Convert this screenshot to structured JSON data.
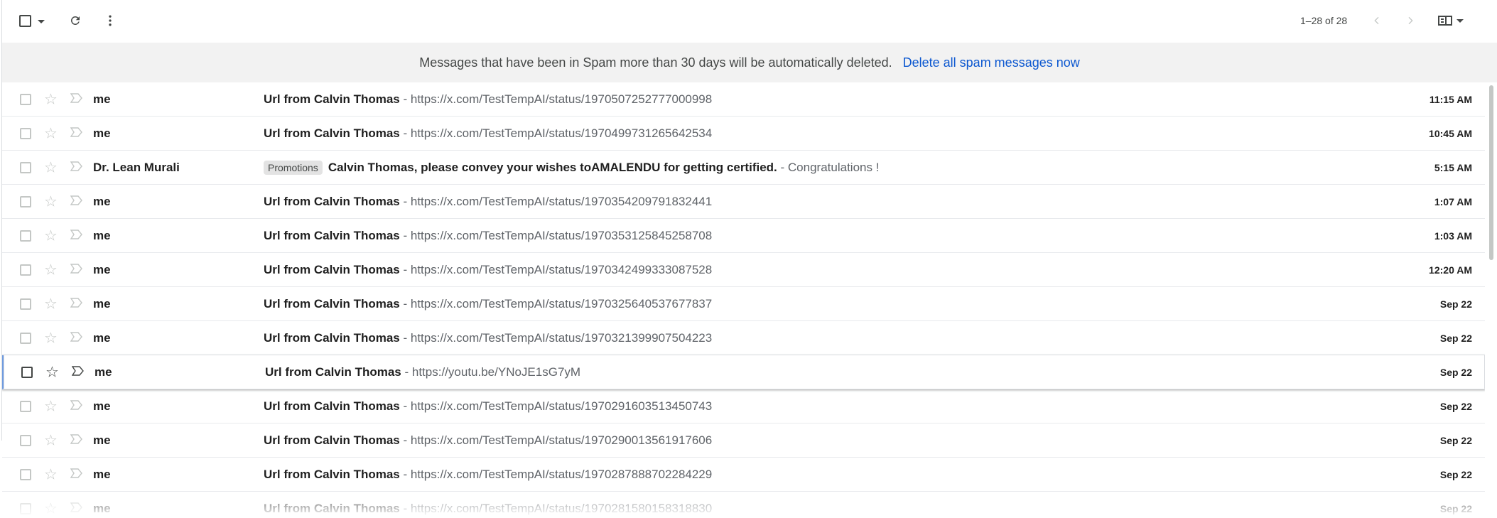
{
  "toolbar": {
    "range_text": "1–28 of 28",
    "icons": [
      "select-all-checkbox",
      "select-dropdown-caret",
      "refresh",
      "more-vert",
      "newer-chevron",
      "older-chevron",
      "split-pane-toggle"
    ]
  },
  "banner": {
    "text": "Messages that have been in Spam more than 30 days will be automatically deleted.",
    "link": "Delete all spam messages now"
  },
  "emails": [
    {
      "sender": "me",
      "subject": "Url from Calvin Thomas",
      "snippet": "- https://x.com/TestTempAI/status/1970507252777000998",
      "date": "11:15 AM"
    },
    {
      "sender": "me",
      "subject": "Url from Calvin Thomas",
      "snippet": "- https://x.com/TestTempAI/status/1970499731265642534",
      "date": "10:45 AM"
    },
    {
      "sender": "Dr. Lean Murali",
      "label": "Promotions",
      "subject": "Calvin Thomas, please convey your wishes toAMALENDU for getting certified.",
      "snippet": "- Congratulations !",
      "date": "5:15 AM"
    },
    {
      "sender": "me",
      "subject": "Url from Calvin Thomas",
      "snippet": "- https://x.com/TestTempAI/status/1970354209791832441",
      "date": "1:07 AM"
    },
    {
      "sender": "me",
      "subject": "Url from Calvin Thomas",
      "snippet": "- https://x.com/TestTempAI/status/1970353125845258708",
      "date": "1:03 AM"
    },
    {
      "sender": "me",
      "subject": "Url from Calvin Thomas",
      "snippet": "- https://x.com/TestTempAI/status/1970342499333087528",
      "date": "12:20 AM"
    },
    {
      "sender": "me",
      "subject": "Url from Calvin Thomas",
      "snippet": "- https://x.com/TestTempAI/status/1970325640537677837",
      "date": "Sep 22"
    },
    {
      "sender": "me",
      "subject": "Url from Calvin Thomas",
      "snippet": "- https://x.com/TestTempAI/status/1970321399907504223",
      "date": "Sep 22"
    },
    {
      "sender": "me",
      "subject": "Url from Calvin Thomas",
      "snippet": "- https://youtu.be/YNoJE1sG7yM",
      "date": "Sep 22"
    },
    {
      "sender": "me",
      "subject": "Url from Calvin Thomas",
      "snippet": "- https://x.com/TestTempAI/status/1970291603513450743",
      "date": "Sep 22"
    },
    {
      "sender": "me",
      "subject": "Url from Calvin Thomas",
      "snippet": "- https://x.com/TestTempAI/status/1970290013561917606",
      "date": "Sep 22"
    },
    {
      "sender": "me",
      "subject": "Url from Calvin Thomas",
      "snippet": "- https://x.com/TestTempAI/status/1970287888702284229",
      "date": "Sep 22"
    },
    {
      "sender": "me",
      "subject": "Url from Calvin Thomas",
      "snippet": "- https://x.com/TestTempAI/status/1970281580158318830",
      "date": "Sep 22"
    }
  ]
}
